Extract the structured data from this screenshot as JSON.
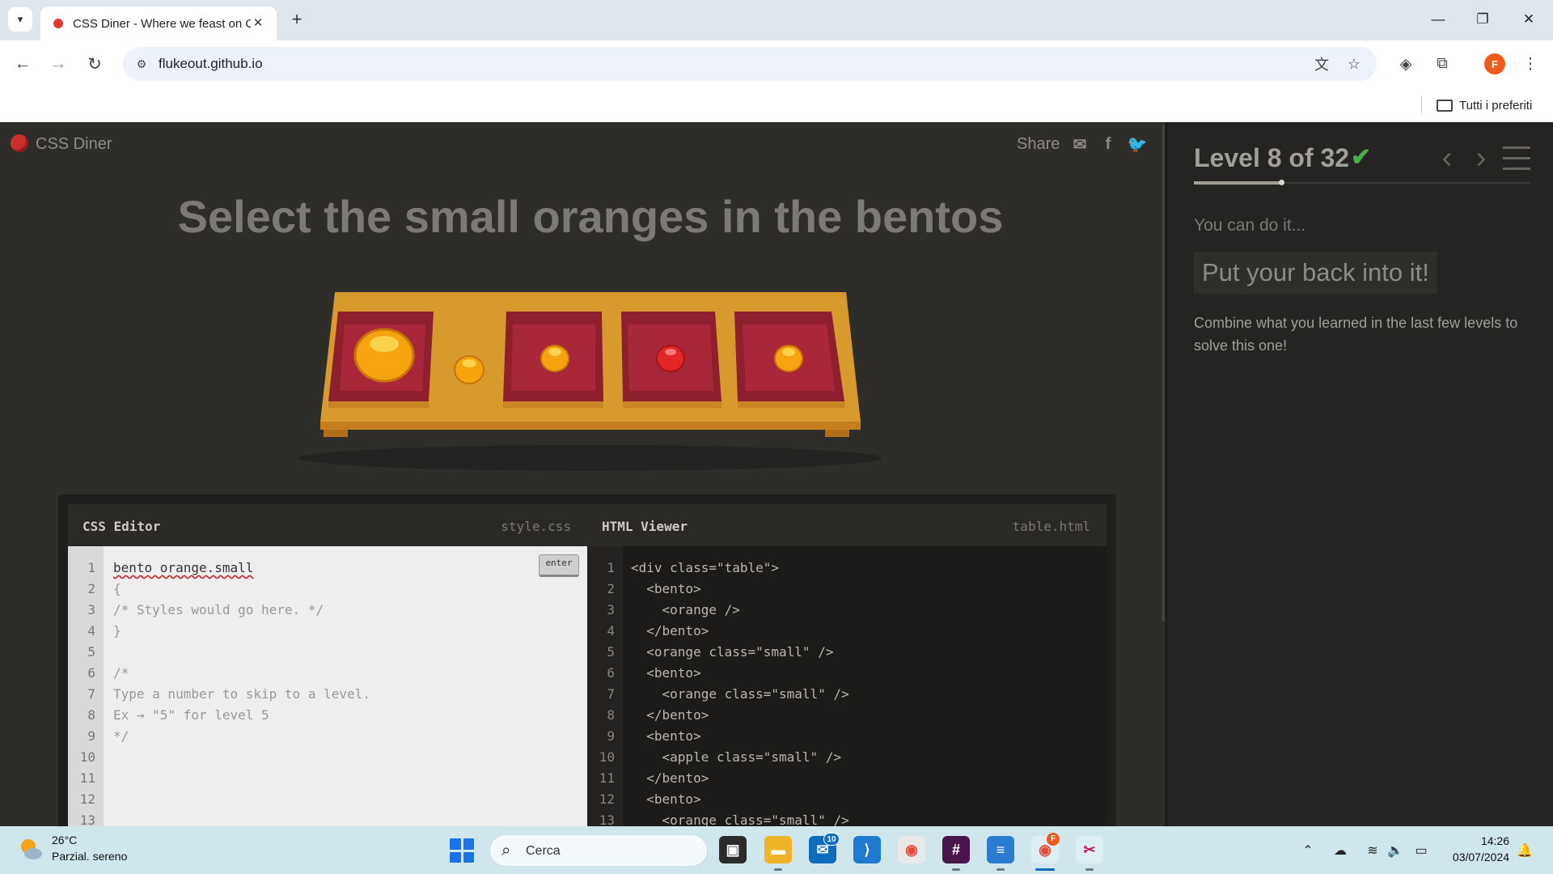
{
  "browser": {
    "tab_title": "CSS Diner - Where we feast on CSS Selectors!",
    "url": "flukeout.github.io",
    "profile_initial": "F",
    "bookmarks_folder": "Tutti i preferiti"
  },
  "game": {
    "logo": "CSS Diner",
    "share_label": "Share",
    "instruction": "Select the small oranges in the bentos"
  },
  "css_editor": {
    "title": "CSS Editor",
    "file": "style.css",
    "enter_label": "enter",
    "line_numbers": "1\n2\n3\n4\n5\n6\n7\n8\n9\n10\n11\n12\n13",
    "selector_input": "bento orange.small",
    "code_rest": "{\n/* Styles would go here. */\n}\n\n/*\nType a number to skip to a level.\nEx → \"5\" for level 5\n*/"
  },
  "html_viewer": {
    "title": "HTML Viewer",
    "file": "table.html",
    "line_numbers": "1\n2\n3\n4\n5\n6\n7\n8\n9\n10\n11\n12\n13",
    "code": "<div class=\"table\">\n  <bento>\n    <orange />\n  </bento>\n  <orange class=\"small\" />\n  <bento>\n    <orange class=\"small\" />\n  </bento>\n  <bento>\n    <apple class=\"small\" />\n  </bento>\n  <bento>\n    <orange class=\"small\" />"
  },
  "sidebar": {
    "level_title": "Level 8 of 32",
    "level_current": 8,
    "level_total": 32,
    "completed": true,
    "hint_intro": "You can do it...",
    "hint_phrase": "Put your back into it!",
    "hint_desc": "Combine what you learned in the last few levels to solve this one!"
  },
  "taskbar": {
    "weather_temp": "26°C",
    "weather_desc": "Parzial. sereno",
    "search_label": "Cerca",
    "mail_badge": "10",
    "chrome_badge": "F",
    "time": "14:26",
    "date": "03/07/2024"
  },
  "colors": {
    "table_wood": "#e0a02e",
    "bento_red": "#a8283a",
    "orange_fruit": "#f5a40f",
    "apple_fruit": "#e32626",
    "check_green": "#4cae4c"
  }
}
